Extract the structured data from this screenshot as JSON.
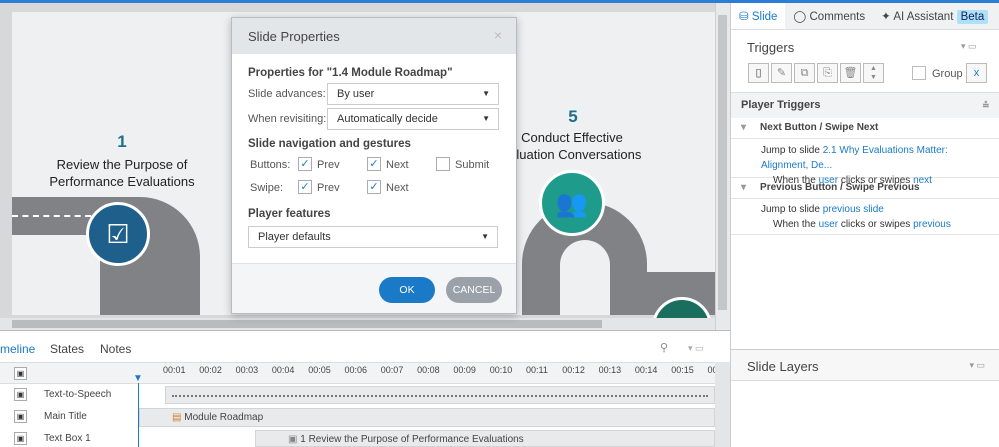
{
  "slide": {
    "steps": [
      {
        "number": "1",
        "title_line1": "Review the Purpose of",
        "title_line2": "Performance Evaluations",
        "icon": "clipboard-checklist-icon"
      },
      {
        "number": "5",
        "title_line1": "Conduct Effective",
        "title_line2": "valuation Conversations",
        "icon": "conversation-people-icon"
      }
    ],
    "colors": {
      "road": "#808285",
      "step_icon_blue": "#1e5f8c",
      "step_icon_teal": "#1e9b8a"
    }
  },
  "dialog": {
    "title": "Slide Properties",
    "close_icon": "×",
    "properties_for": "Properties for \"1.4 Module Roadmap\"",
    "slide_advances_label": "Slide advances:",
    "slide_advances_value": "By user",
    "when_revisiting_label": "When revisiting:",
    "when_revisiting_value": "Automatically decide",
    "nav_section": "Slide navigation and gestures",
    "buttons_label": "Buttons:",
    "swipe_label": "Swipe:",
    "prev": "Prev",
    "next": "Next",
    "submit": "Submit",
    "buttons_prev_checked": true,
    "buttons_next_checked": true,
    "buttons_submit_checked": false,
    "swipe_prev_checked": true,
    "swipe_next_checked": true,
    "player_features_section": "Player features",
    "player_features_value": "Player defaults",
    "ok": "OK",
    "cancel": "CANCEL"
  },
  "right_panel": {
    "tabs": [
      {
        "label": "Slide",
        "icon": "slide-icon"
      },
      {
        "label": "Comments",
        "icon": "comment-icon"
      },
      {
        "label": "AI Assistant",
        "icon": "sparkle-icon",
        "badge": "Beta"
      }
    ],
    "triggers_title": "Triggers",
    "group_label": "Group",
    "player_triggers_title": "Player Triggers",
    "triggers": [
      {
        "title": "Next Button / Swipe Next",
        "action_prefix": "Jump to slide ",
        "action_target": "2.1 Why Evaluations Matter: Alignment, De...",
        "cond_prefix": "When the ",
        "cond_user": "user",
        "cond_mid": " clicks or swipes ",
        "cond_target": "next"
      },
      {
        "title": "Previous Button / Swipe Previous",
        "action_prefix": "Jump to slide ",
        "action_target": "previous slide",
        "cond_prefix": "When the ",
        "cond_user": "user",
        "cond_mid": " clicks or swipes ",
        "cond_target": "previous"
      }
    ],
    "slide_layers_title": "Slide Layers"
  },
  "timeline": {
    "tabs": [
      "meline",
      "States",
      "Notes"
    ],
    "ticks": [
      "00:01",
      "00:02",
      "00:03",
      "00:04",
      "00:05",
      "00:06",
      "00:07",
      "00:08",
      "00:09",
      "00:10",
      "00:11",
      "00:12",
      "00:13",
      "00:14",
      "00:15",
      "00"
    ],
    "rows": [
      {
        "label": "Text-to-Speech",
        "bar": ""
      },
      {
        "label": "Main Title",
        "bar": "Module Roadmap"
      },
      {
        "label": "Text Box 1",
        "bar": "1 Review the Purpose of Performance Evaluations"
      }
    ]
  }
}
